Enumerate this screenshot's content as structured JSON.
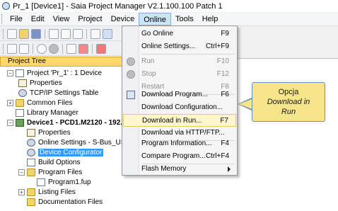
{
  "window": {
    "title": "Pr_1 [Device1] - Saia Project Manager V2.1.100.100 Patch 1"
  },
  "menu": [
    "File",
    "Edit",
    "View",
    "Project",
    "Device",
    "Online",
    "Tools",
    "Help"
  ],
  "panel": {
    "title": "Project Tree"
  },
  "tree": [
    {
      "label": "Project 'Pr_1' : 1 Device"
    },
    {
      "label": "Properties"
    },
    {
      "label": "TCP/IP Settings Table"
    },
    {
      "label": "Common Files"
    },
    {
      "label": "Library Manager"
    },
    {
      "label": "Device1 - PCD1.M2120 - 192.16"
    },
    {
      "label": "Properties"
    },
    {
      "label": "Online Settings - S-Bus_USB: S"
    },
    {
      "label": "Device Configurator"
    },
    {
      "label": "Build Options"
    },
    {
      "label": "Program Files"
    },
    {
      "label": "Program1.fup"
    },
    {
      "label": "Listing Files"
    },
    {
      "label": "Documentation Files"
    }
  ],
  "online_menu": [
    {
      "label": "Go Online",
      "shortcut": "F9"
    },
    {
      "label": "Online Settings...",
      "shortcut": "Ctrl+F9"
    },
    {
      "label": "Run",
      "shortcut": "F10"
    },
    {
      "label": "Stop",
      "shortcut": "F12"
    },
    {
      "label": "Restart",
      "shortcut": "F8"
    },
    {
      "label": "Download Program...",
      "shortcut": "F6"
    },
    {
      "label": "Download Configuration...",
      "shortcut": ""
    },
    {
      "label": "Download in Run...",
      "shortcut": "F7"
    },
    {
      "label": "Download via HTTP/FTP...",
      "shortcut": ""
    },
    {
      "label": "Program Information...",
      "shortcut": "F4"
    },
    {
      "label": "Compare Program...",
      "shortcut": "Ctrl+F4"
    },
    {
      "label": "Flash Memory",
      "shortcut": ""
    }
  ],
  "callout": {
    "line1": "Opcja",
    "line2": "Download in",
    "line3": "Run"
  },
  "colors": {
    "highlight": "#fff6cf",
    "callout_fill": "#f6e58a",
    "panel_header": "#ffd86a",
    "selection": "#3399ff"
  }
}
